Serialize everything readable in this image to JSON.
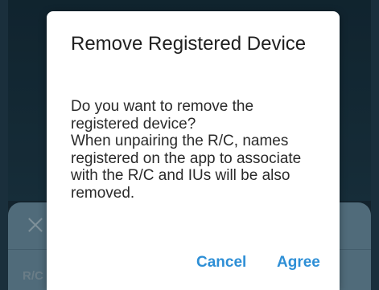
{
  "background_sheet": {
    "close_icon": "close-icon",
    "label": "R/C"
  },
  "dialog": {
    "title": "Remove Registered Device",
    "message": "Do you want to remove the registered device?\nWhen unpairing the R/C, names registered on the app to associate with the R/C and IUs will be also removed.",
    "cancel_label": "Cancel",
    "agree_label": "Agree"
  },
  "colors": {
    "accent": "#2e8fd6",
    "dialog_bg": "#ffffff",
    "sheet_bg": "#6b8fa3"
  }
}
